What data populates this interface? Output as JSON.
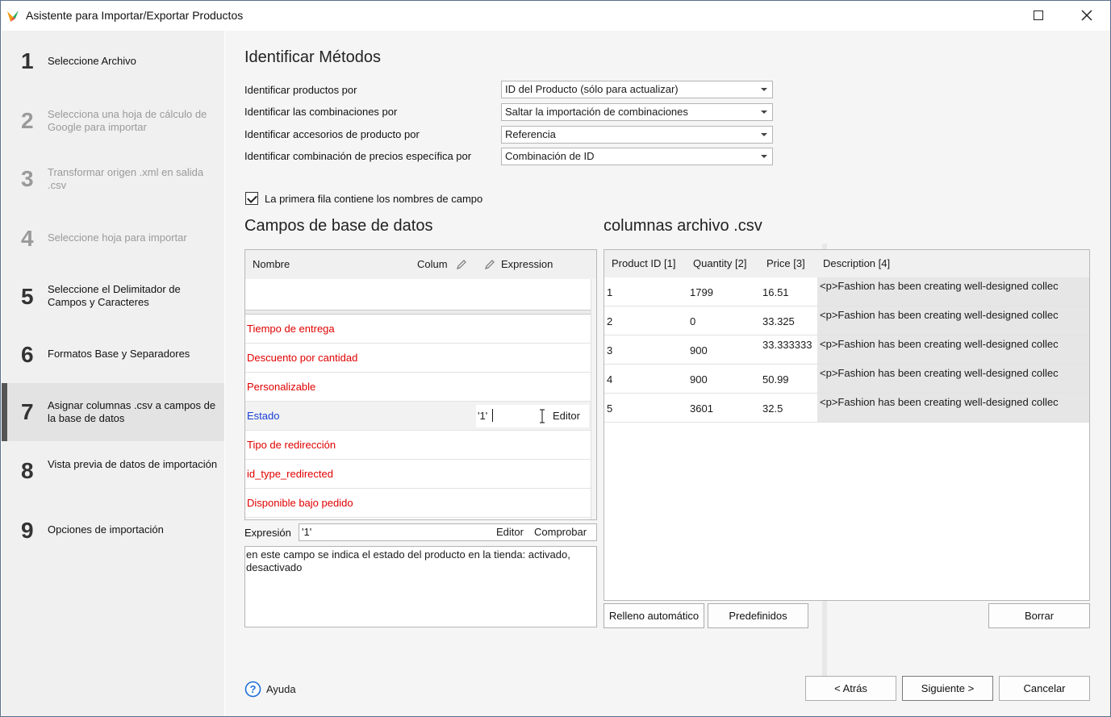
{
  "window": {
    "title": "Asistente para Importar/Exportar Productos"
  },
  "steps": [
    {
      "num": "1",
      "label": "Seleccione Archivo",
      "state": "normal"
    },
    {
      "num": "2",
      "label": "Selecciona una hoja de cálculo de Google para importar",
      "state": "dim"
    },
    {
      "num": "3",
      "label": "Transformar origen .xml en salida .csv",
      "state": "dim"
    },
    {
      "num": "4",
      "label": "Seleccione hoja para importar",
      "state": "dim"
    },
    {
      "num": "5",
      "label": "Seleccione el Delimitador de Campos y Caracteres",
      "state": "normal"
    },
    {
      "num": "6",
      "label": "Formatos Base y Separadores",
      "state": "normal"
    },
    {
      "num": "7",
      "label": "Asignar columnas .csv a campos de la base de datos",
      "state": "active"
    },
    {
      "num": "8",
      "label": "Vista previa de datos de importación",
      "state": "normal"
    },
    {
      "num": "9",
      "label": "Opciones de importación",
      "state": "normal"
    }
  ],
  "identify": {
    "heading": "Identificar Métodos",
    "rows": [
      {
        "label": "Identificar productos por",
        "value": "ID del Producto (sólo para actualizar)"
      },
      {
        "label": "Identificar las combinaciones por",
        "value": "Saltar la importación de combinaciones"
      },
      {
        "label": "Identificar accesorios de producto por",
        "value": "Referencia"
      },
      {
        "label": "Identificar combinación de precios específica por",
        "value": "Combinación de ID"
      }
    ],
    "checkbox_label": "La primera fila contiene los nombres de campo"
  },
  "db": {
    "heading": "Campos de base de datos",
    "headers": {
      "name": "Nombre",
      "column": "Colum",
      "expression": "Expression"
    },
    "fields": [
      {
        "name": "Tiempo de entrega",
        "color": "red",
        "value": "",
        "editor": ""
      },
      {
        "name": "Descuento por cantidad",
        "color": "red",
        "value": "",
        "editor": ""
      },
      {
        "name": "Personalizable",
        "color": "red",
        "value": "",
        "editor": ""
      },
      {
        "name": "Estado",
        "color": "blue",
        "value": "'1'",
        "editor": "Editor"
      },
      {
        "name": "Tipo de redirección",
        "color": "red",
        "value": "",
        "editor": ""
      },
      {
        "name": "id_type_redirected",
        "color": "red",
        "value": "",
        "editor": ""
      },
      {
        "name": "Disponible bajo pedido",
        "color": "red",
        "value": "",
        "editor": ""
      }
    ],
    "expression_label": "Expresión",
    "expression_value": "'1'",
    "editor_label": "Editor",
    "check_label": "Comprobar",
    "description": "en este campo se indica el estado del producto en la tienda: activado, desactivado"
  },
  "csv": {
    "heading": "columnas archivo .csv",
    "headers": [
      "Product ID [1]",
      "Quantity [2]",
      "Price [3]",
      "Description [4]"
    ],
    "rows": [
      [
        "1",
        "1799",
        "16.51",
        "<p>Fashion has been creating well-designed collec"
      ],
      [
        "2",
        "0",
        "33.325",
        "<p>Fashion has been creating well-designed collec"
      ],
      [
        "3",
        "900",
        "33.333333",
        "<p>Fashion has been creating well-designed collec"
      ],
      [
        "4",
        "900",
        "50.99",
        "<p>Fashion has been creating well-designed collec"
      ],
      [
        "5",
        "3601",
        "32.5",
        "<p>Fashion has been creating well-designed collec"
      ]
    ],
    "buttons": {
      "autofill": "Relleno automático",
      "predefined": "Predefinidos",
      "clear": "Borrar"
    }
  },
  "footer": {
    "help": "Ayuda",
    "back": "< Atrás",
    "next": "Siguiente >",
    "cancel": "Cancelar"
  },
  "colors": {
    "red_field": "#e00000",
    "blue_field": "#1a3fd6",
    "sidebar_bg": "#f0f0f0",
    "content_bg": "#f5f5f5"
  }
}
